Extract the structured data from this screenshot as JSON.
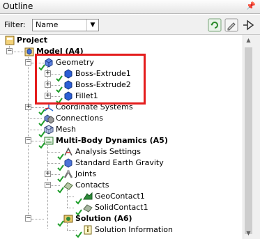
{
  "window": {
    "title": "Outline",
    "pin_glyph": "ᵖ"
  },
  "toolbar": {
    "filter_label": "Filter:",
    "filter_value": "Name"
  },
  "tree": {
    "project": "Project",
    "model": "Model (A4)",
    "geometry": "Geometry",
    "boss1": "Boss-Extrude1",
    "boss2": "Boss-Extrude2",
    "fillet": "Fillet1",
    "coords": "Coordinate Systems",
    "connections": "Connections",
    "mesh": "Mesh",
    "mbd": "Multi-Body Dynamics (A5)",
    "analysis": "Analysis Settings",
    "gravity": "Standard Earth Gravity",
    "joints": "Joints",
    "contacts": "Contacts",
    "geocontact": "GeoContact1",
    "solidcontact": "SolidContact1",
    "solution": "Solution (A6)",
    "solinfo": "Solution Information"
  },
  "colors": {
    "highlight": "#e41d1d",
    "check": "#1e9e2a",
    "body_blue": "#2c5fd6"
  }
}
